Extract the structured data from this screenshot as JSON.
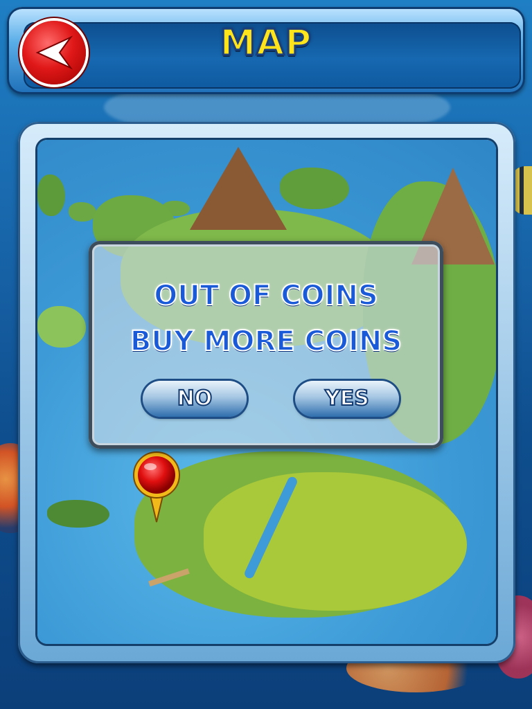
{
  "header": {
    "title": "MAP",
    "back_icon": "back-arrow-icon"
  },
  "dialog": {
    "line1": "OUT OF COINS",
    "line2": "BUY MORE COINS",
    "no_label": "NO",
    "yes_label": "YES"
  },
  "map": {
    "pin_icon": "location-pin-icon"
  },
  "colors": {
    "title": "#ffe41c",
    "dialog_text": "#1a5ad8",
    "back_button": "#e01818",
    "header": "#1668b0"
  }
}
